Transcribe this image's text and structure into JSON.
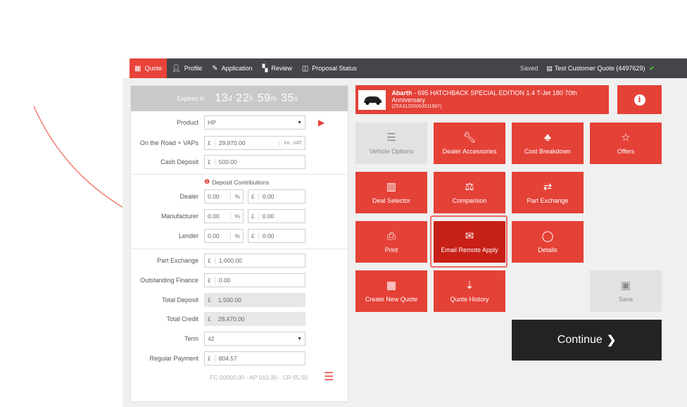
{
  "nav": {
    "tabs": [
      {
        "label": "Quote",
        "icon": "calculator-icon"
      },
      {
        "label": "Profile",
        "icon": "user-icon"
      },
      {
        "label": "Application",
        "icon": "pencil-icon"
      },
      {
        "label": "Review",
        "icon": "grid-icon"
      },
      {
        "label": "Proposal Status",
        "icon": "columns-icon"
      }
    ],
    "saved": "Saved",
    "quote_ref": "Test Customer Quote (4497629)"
  },
  "expires": {
    "label": "Expires In",
    "days": "13",
    "d": "d",
    "hours": "22",
    "h": "h",
    "mins": "59",
    "m": "m",
    "secs": "35",
    "s": "s"
  },
  "form": {
    "product_label": "Product",
    "product_value": "HP",
    "otr_label": "On the Road + VAPs",
    "otr_value": "29,970.00",
    "otr_badge": "Inc. VAT",
    "cash_deposit_label": "Cash Deposit",
    "cash_deposit_value": "500.00",
    "deposit_contrib_label": "Deposit Contributions",
    "dealer_label": "Dealer",
    "dealer_pct": "0.00",
    "dealer_amt": "0.00",
    "manufacturer_label": "Manufacturer",
    "manufacturer_pct": "0.00",
    "manufacturer_amt": "0.00",
    "lender_label": "Lender",
    "lender_pct": "0.00",
    "lender_amt": "0.00",
    "part_exchange_label": "Part Exchange",
    "part_exchange_value": "1,000.00",
    "outstanding_label": "Outstanding Finance",
    "outstanding_value": "0.00",
    "total_deposit_label": "Total Deposit",
    "total_deposit_value": "1,500.00",
    "total_credit_label": "Total Credit",
    "total_credit_value": "28,470.00",
    "term_label": "Term",
    "term_value": "42",
    "regular_payment_label": "Regular Payment",
    "regular_payment_value": "804.57",
    "footnote": "FC 00000.00 - AP 010.30 - CR 05.00",
    "currency": "£",
    "percent": "%"
  },
  "vehicle": {
    "make": "Abarth",
    "model": " - 695 HATCHBACK SPECIAL EDITION 1.4 T-Jet 180 70th Anniversary",
    "code": "(ZFA3120000J011997)"
  },
  "tiles": {
    "vehicle_options": "Vehicle Options",
    "dealer_accessories": "Dealer Accessories",
    "cost_breakdown": "Cost Breakdown",
    "offers": "Offers",
    "deal_selector": "Deal Selector",
    "comparison": "Comparison",
    "part_exchange": "Part Exchange",
    "print": "Print",
    "email_remote_apply": "Email Remote Apply",
    "details": "Details",
    "create_new_quote": "Create New Quote",
    "quote_history": "Quote History",
    "save": "Save"
  },
  "continue_label": "Continue",
  "colors": {
    "accent": "#e44137",
    "topbar": "#444548",
    "continue": "#232323",
    "highlight": "#ee6a62"
  }
}
